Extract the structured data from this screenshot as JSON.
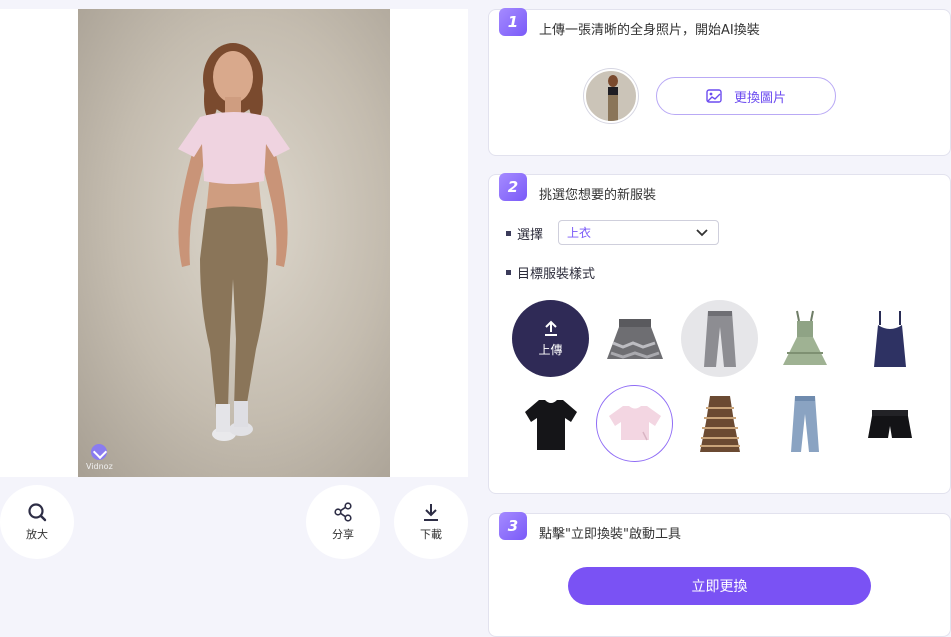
{
  "preview": {
    "brand_text": "Vidnoz",
    "actions": [
      {
        "label": "放大",
        "icon": "search-icon"
      },
      {
        "label": "分享",
        "icon": "share-icon"
      },
      {
        "label": "下載",
        "icon": "download-icon"
      }
    ]
  },
  "step1": {
    "number": "1",
    "title": "上傳一張清晰的全身照片，開始AI換裝",
    "replace_label": "更換圖片"
  },
  "step2": {
    "number": "2",
    "title": "挑選您想要的新服裝",
    "select_label": "選擇",
    "select_value": "上衣",
    "style_label": "目標服裝樣式",
    "upload_label": "上傳",
    "garments": [
      "skirt",
      "jeans-grey",
      "green-dress",
      "navy-tank-top",
      "black-tshirt",
      "pink-crop-top",
      "striped-dress",
      "blue-jeans",
      "black-shorts"
    ]
  },
  "step3": {
    "number": "3",
    "title": "點擊\"立即換裝\"啟動工具",
    "go_label": "立即更換"
  },
  "colors": {
    "accent": "#7a52f4",
    "upload_bg": "#2f2a56"
  }
}
